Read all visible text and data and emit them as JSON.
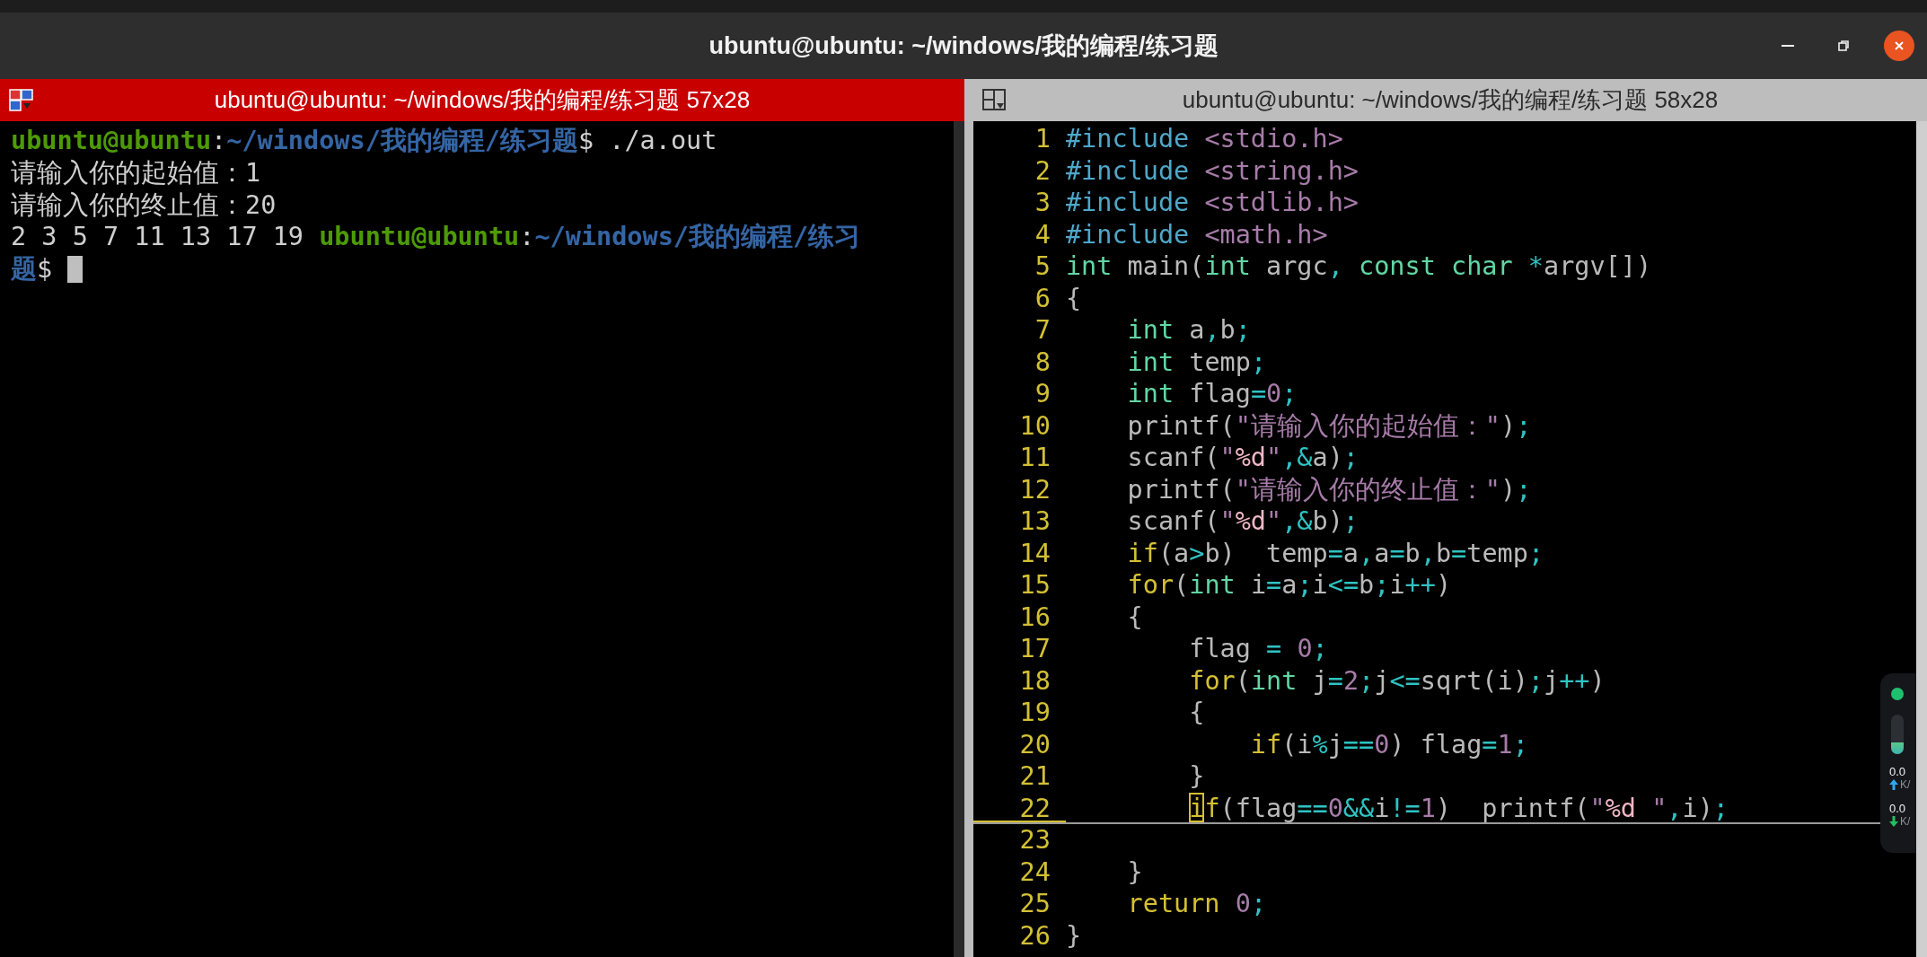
{
  "window": {
    "title": "ubuntu@ubuntu: ~/windows/我的编程/练习题"
  },
  "panes": [
    {
      "title": "ubuntu@ubuntu: ~/windows/我的编程/练习题 57x28",
      "focused": true
    },
    {
      "title": "ubuntu@ubuntu: ~/windows/我的编程/练习题 58x28",
      "focused": false
    }
  ],
  "shell_lines": [
    {
      "segments": [
        {
          "kind": "user",
          "text": "ubuntu@ubuntu"
        },
        {
          "kind": "plain",
          "text": ":"
        },
        {
          "kind": "path",
          "text": "~/windows/我的编程/练习题"
        },
        {
          "kind": "plain",
          "text": "$ ./a.out"
        }
      ],
      "cursor": false
    },
    {
      "segments": [
        {
          "kind": "plain",
          "text": "请输入你的起始值：1"
        }
      ],
      "cursor": false
    },
    {
      "segments": [
        {
          "kind": "plain",
          "text": "请输入你的终止值：20"
        }
      ],
      "cursor": false
    },
    {
      "segments": [
        {
          "kind": "plain",
          "text": "2 3 5 7 11 13 17 19"
        },
        {
          "kind": "user",
          "text": " ubuntu@ubuntu"
        },
        {
          "kind": "plain",
          "text": ":"
        },
        {
          "kind": "path",
          "text": "~/windows/我的编程/练习"
        }
      ],
      "cursor": false
    },
    {
      "segments": [
        {
          "kind": "path",
          "text": "题"
        },
        {
          "kind": "plain",
          "text": "$"
        }
      ],
      "cursor": true
    }
  ],
  "code_lines": [
    {
      "number": "1",
      "cursorline": false,
      "tokens": [
        {
          "kind": "preproc",
          "text": "#include"
        },
        {
          "kind": "header",
          "text": " <stdio.h>"
        }
      ]
    },
    {
      "number": "2",
      "cursorline": false,
      "tokens": [
        {
          "kind": "preproc",
          "text": "#include"
        },
        {
          "kind": "header",
          "text": " <string.h>"
        }
      ]
    },
    {
      "number": "3",
      "cursorline": false,
      "tokens": [
        {
          "kind": "preproc",
          "text": "#include"
        },
        {
          "kind": "header",
          "text": " <stdlib.h>"
        }
      ]
    },
    {
      "number": "4",
      "cursorline": false,
      "tokens": [
        {
          "kind": "preproc",
          "text": "#include"
        },
        {
          "kind": "header",
          "text": " <math.h>"
        }
      ]
    },
    {
      "number": "5",
      "cursorline": false,
      "tokens": [
        {
          "kind": "type",
          "text": "int"
        },
        {
          "kind": "plain",
          "text": " main("
        },
        {
          "kind": "type",
          "text": "int"
        },
        {
          "kind": "plain",
          "text": " argc"
        },
        {
          "kind": "punct",
          "text": ","
        },
        {
          "kind": "type",
          "text": " const"
        },
        {
          "kind": "type",
          "text": " char"
        },
        {
          "kind": "punct",
          "text": " *"
        },
        {
          "kind": "plain",
          "text": "argv[])"
        }
      ]
    },
    {
      "number": "6",
      "cursorline": false,
      "tokens": [
        {
          "kind": "plain",
          "text": "{"
        }
      ]
    },
    {
      "number": "7",
      "cursorline": false,
      "tokens": [
        {
          "kind": "type",
          "text": "    int"
        },
        {
          "kind": "plain",
          "text": " a"
        },
        {
          "kind": "punct",
          "text": ","
        },
        {
          "kind": "plain",
          "text": "b"
        },
        {
          "kind": "punct",
          "text": ";"
        }
      ]
    },
    {
      "number": "8",
      "cursorline": false,
      "tokens": [
        {
          "kind": "type",
          "text": "    int"
        },
        {
          "kind": "plain",
          "text": " temp"
        },
        {
          "kind": "punct",
          "text": ";"
        }
      ]
    },
    {
      "number": "9",
      "cursorline": false,
      "tokens": [
        {
          "kind": "type",
          "text": "    int"
        },
        {
          "kind": "plain",
          "text": " flag"
        },
        {
          "kind": "punct",
          "text": "="
        },
        {
          "kind": "number",
          "text": "0"
        },
        {
          "kind": "punct",
          "text": ";"
        }
      ]
    },
    {
      "number": "10",
      "cursorline": false,
      "tokens": [
        {
          "kind": "plain",
          "text": "    printf("
        },
        {
          "kind": "string",
          "text": "\"请输入你的起始值：\""
        },
        {
          "kind": "plain",
          "text": ")"
        },
        {
          "kind": "punct",
          "text": ";"
        }
      ]
    },
    {
      "number": "11",
      "cursorline": false,
      "tokens": [
        {
          "kind": "plain",
          "text": "    scanf("
        },
        {
          "kind": "string",
          "text": "\""
        },
        {
          "kind": "format",
          "text": "%d"
        },
        {
          "kind": "string",
          "text": "\""
        },
        {
          "kind": "punct",
          "text": ",&"
        },
        {
          "kind": "plain",
          "text": "a)"
        },
        {
          "kind": "punct",
          "text": ";"
        }
      ]
    },
    {
      "number": "12",
      "cursorline": false,
      "tokens": [
        {
          "kind": "plain",
          "text": "    printf("
        },
        {
          "kind": "string",
          "text": "\"请输入你的终止值：\""
        },
        {
          "kind": "plain",
          "text": ")"
        },
        {
          "kind": "punct",
          "text": ";"
        }
      ]
    },
    {
      "number": "13",
      "cursorline": false,
      "tokens": [
        {
          "kind": "plain",
          "text": "    scanf("
        },
        {
          "kind": "string",
          "text": "\""
        },
        {
          "kind": "format",
          "text": "%d"
        },
        {
          "kind": "string",
          "text": "\""
        },
        {
          "kind": "punct",
          "text": ",&"
        },
        {
          "kind": "plain",
          "text": "b)"
        },
        {
          "kind": "punct",
          "text": ";"
        }
      ]
    },
    {
      "number": "14",
      "cursorline": false,
      "tokens": [
        {
          "kind": "keyword",
          "text": "    if"
        },
        {
          "kind": "plain",
          "text": "(a"
        },
        {
          "kind": "punct",
          "text": ">"
        },
        {
          "kind": "plain",
          "text": "b)  temp"
        },
        {
          "kind": "punct",
          "text": "="
        },
        {
          "kind": "plain",
          "text": "a"
        },
        {
          "kind": "punct",
          "text": ","
        },
        {
          "kind": "plain",
          "text": "a"
        },
        {
          "kind": "punct",
          "text": "="
        },
        {
          "kind": "plain",
          "text": "b"
        },
        {
          "kind": "punct",
          "text": ","
        },
        {
          "kind": "plain",
          "text": "b"
        },
        {
          "kind": "punct",
          "text": "="
        },
        {
          "kind": "plain",
          "text": "temp"
        },
        {
          "kind": "punct",
          "text": ";"
        }
      ]
    },
    {
      "number": "15",
      "cursorline": false,
      "tokens": [
        {
          "kind": "keyword",
          "text": "    for"
        },
        {
          "kind": "plain",
          "text": "("
        },
        {
          "kind": "type",
          "text": "int"
        },
        {
          "kind": "plain",
          "text": " i"
        },
        {
          "kind": "punct",
          "text": "="
        },
        {
          "kind": "plain",
          "text": "a"
        },
        {
          "kind": "punct",
          "text": ";"
        },
        {
          "kind": "plain",
          "text": "i"
        },
        {
          "kind": "punct",
          "text": "<="
        },
        {
          "kind": "plain",
          "text": "b"
        },
        {
          "kind": "punct",
          "text": ";"
        },
        {
          "kind": "plain",
          "text": "i"
        },
        {
          "kind": "punct",
          "text": "++"
        },
        {
          "kind": "plain",
          "text": ")"
        }
      ]
    },
    {
      "number": "16",
      "cursorline": false,
      "tokens": [
        {
          "kind": "plain",
          "text": "    {"
        }
      ]
    },
    {
      "number": "17",
      "cursorline": false,
      "tokens": [
        {
          "kind": "plain",
          "text": "        flag"
        },
        {
          "kind": "punct",
          "text": " ="
        },
        {
          "kind": "number",
          "text": " 0"
        },
        {
          "kind": "punct",
          "text": ";"
        }
      ]
    },
    {
      "number": "18",
      "cursorline": false,
      "tokens": [
        {
          "kind": "keyword",
          "text": "        for"
        },
        {
          "kind": "plain",
          "text": "("
        },
        {
          "kind": "type",
          "text": "int"
        },
        {
          "kind": "plain",
          "text": " j"
        },
        {
          "kind": "punct",
          "text": "="
        },
        {
          "kind": "number",
          "text": "2"
        },
        {
          "kind": "punct",
          "text": ";"
        },
        {
          "kind": "plain",
          "text": "j"
        },
        {
          "kind": "punct",
          "text": "<="
        },
        {
          "kind": "plain",
          "text": "sqrt(i)"
        },
        {
          "kind": "punct",
          "text": ";"
        },
        {
          "kind": "plain",
          "text": "j"
        },
        {
          "kind": "punct",
          "text": "++"
        },
        {
          "kind": "plain",
          "text": ")"
        }
      ]
    },
    {
      "number": "19",
      "cursorline": false,
      "tokens": [
        {
          "kind": "plain",
          "text": "        {"
        }
      ]
    },
    {
      "number": "20",
      "cursorline": false,
      "tokens": [
        {
          "kind": "keyword",
          "text": "            if"
        },
        {
          "kind": "plain",
          "text": "(i"
        },
        {
          "kind": "punct",
          "text": "%"
        },
        {
          "kind": "plain",
          "text": "j"
        },
        {
          "kind": "punct",
          "text": "=="
        },
        {
          "kind": "number",
          "text": "0"
        },
        {
          "kind": "plain",
          "text": ") flag"
        },
        {
          "kind": "punct",
          "text": "="
        },
        {
          "kind": "number",
          "text": "1"
        },
        {
          "kind": "punct",
          "text": ";"
        }
      ]
    },
    {
      "number": "21",
      "cursorline": false,
      "tokens": [
        {
          "kind": "plain",
          "text": "        }"
        }
      ]
    },
    {
      "number": "22",
      "cursorline": true,
      "tokens": [
        {
          "kind": "cursor",
          "text": "        i"
        },
        {
          "kind": "keyword",
          "text": "f"
        },
        {
          "kind": "plain",
          "text": "(flag"
        },
        {
          "kind": "punct",
          "text": "=="
        },
        {
          "kind": "number",
          "text": "0"
        },
        {
          "kind": "punct",
          "text": "&&"
        },
        {
          "kind": "plain",
          "text": "i"
        },
        {
          "kind": "punct",
          "text": "!="
        },
        {
          "kind": "number",
          "text": "1"
        },
        {
          "kind": "plain",
          "text": ")  printf("
        },
        {
          "kind": "string",
          "text": "\""
        },
        {
          "kind": "format",
          "text": "%d"
        },
        {
          "kind": "string",
          "text": " \""
        },
        {
          "kind": "punct",
          "text": ","
        },
        {
          "kind": "plain",
          "text": "i)"
        },
        {
          "kind": "punct",
          "text": ";"
        }
      ]
    },
    {
      "number": "23",
      "cursorline": false
    },
    {
      "number": "24",
      "cursorline": false,
      "tokens": [
        {
          "kind": "plain",
          "text": "    }"
        }
      ]
    },
    {
      "number": "25",
      "cursorline": false,
      "tokens": [
        {
          "kind": "keyword",
          "text": "    return"
        },
        {
          "kind": "number",
          "text": " 0"
        },
        {
          "kind": "punct",
          "text": ";"
        }
      ]
    },
    {
      "number": "26",
      "cursorline": false,
      "tokens": [
        {
          "kind": "plain",
          "text": "}"
        }
      ]
    }
  ],
  "net_widget": {
    "level": 0.3,
    "rates": [
      {
        "kind": "up",
        "value": "0.0",
        "unit": "K/"
      },
      {
        "kind": "down",
        "value": "0.0",
        "unit": "K/"
      }
    ]
  }
}
